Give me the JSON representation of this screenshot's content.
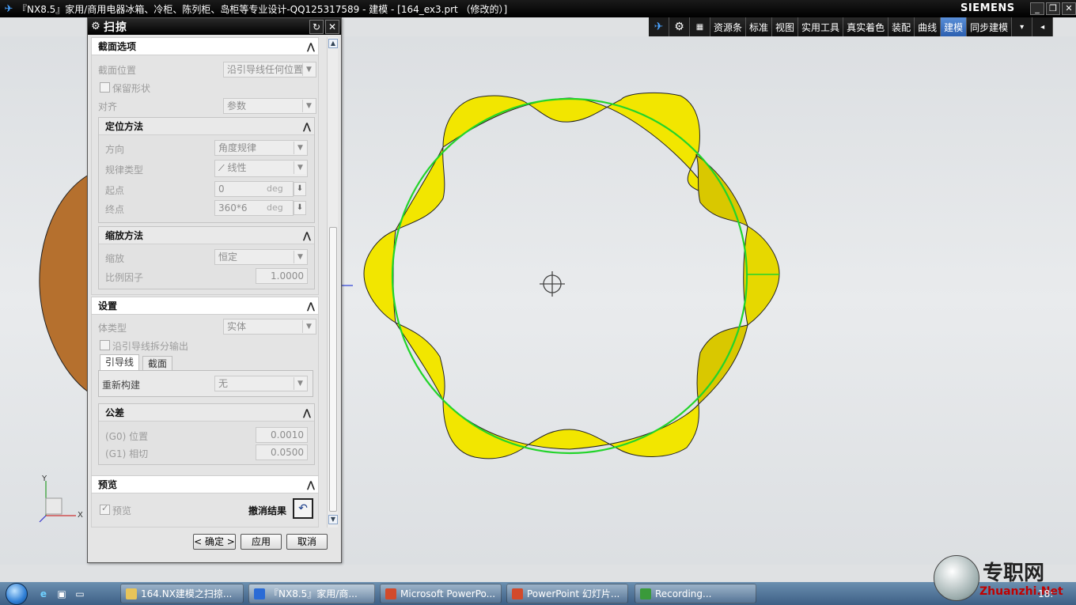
{
  "window": {
    "title": "『NX8.5』家用/商用电器冰箱、冷柜、陈列柜、岛柜等专业设计-QQ125317589 - 建模 - [164_ex3.prt （修改的）]",
    "brand": "SIEMENS",
    "controls": [
      "_",
      "❐",
      "✕"
    ]
  },
  "toolbar": {
    "tabs": [
      "资源条",
      "标准",
      "视图",
      "实用工具",
      "真实着色",
      "装配",
      "曲线",
      "建模",
      "同步建模"
    ],
    "active_tab": "建模"
  },
  "dialog": {
    "title": "扫掠",
    "section_options": {
      "header": "截面选项",
      "position_label": "截面位置",
      "position_value": "沿引导线任何位置",
      "keep_shape_label": "保留形状",
      "align_label": "对齐",
      "align_value": "参数"
    },
    "orientation": {
      "header": "定位方法",
      "direction_label": "方向",
      "direction_value": "角度规律",
      "law_type_label": "规律类型",
      "law_type_value": "线性",
      "start_label": "起点",
      "start_value": "0",
      "end_label": "终点",
      "end_value": "360*6",
      "unit": "deg"
    },
    "scaling": {
      "header": "缩放方法",
      "scale_label": "缩放",
      "scale_value": "恒定",
      "factor_label": "比例因子",
      "factor_value": "1.0000"
    },
    "settings": {
      "header": "设置",
      "body_type_label": "体类型",
      "body_type_value": "实体",
      "split_output_label": "沿引导线拆分输出",
      "tabs": [
        "引导线",
        "截面"
      ],
      "rebuild_label": "重新构建",
      "rebuild_value": "无"
    },
    "tolerance": {
      "header": "公差",
      "g0_label": "(G0) 位置",
      "g0_value": "0.0010",
      "g1_label": "(G1) 相切",
      "g1_value": "0.0500"
    },
    "preview": {
      "header": "预览",
      "preview_label": "预览",
      "undo_label": "撤消结果"
    },
    "buttons": {
      "ok": "< 确定 >",
      "apply": "应用",
      "cancel": "取消"
    }
  },
  "axes": {
    "y": "Y",
    "x": "X"
  },
  "taskbar": {
    "items": [
      "164.NX建模之扫掠...",
      "『NX8.5』家用/商...",
      "Microsoft PowerPo...",
      "PowerPoint 幻灯片...",
      "Recording..."
    ],
    "clock": "18:"
  },
  "watermark": {
    "text": "专职网",
    "url": "Zhuanzhi.Net"
  },
  "colors": {
    "sweep_yellow": "#f2e600",
    "guide_green": "#22d42a",
    "disk_brown": "#b5702e",
    "titlebar": "#000000",
    "active_tab": "#3a70c4"
  }
}
